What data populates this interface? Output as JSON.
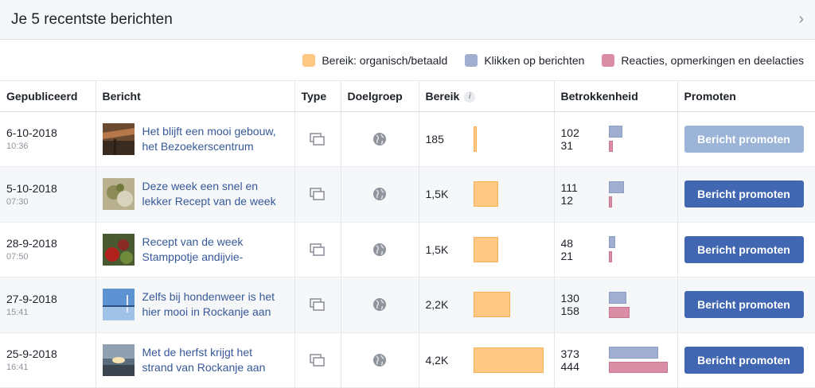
{
  "header": {
    "title": "Je 5 recentste berichten"
  },
  "legend": [
    {
      "label": "Bereik: organisch/betaald",
      "color": "#ffc984"
    },
    {
      "label": "Klikken op berichten",
      "color": "#a0afd0"
    },
    {
      "label": "Reacties, opmerkingen en deelacties",
      "color": "#d98ea6"
    }
  ],
  "columns": [
    "Gepubliceerd",
    "Bericht",
    "Type",
    "Doelgroep",
    "Bereik",
    "Betrokkenheid",
    "Promoten"
  ],
  "rows": [
    {
      "date": "6-10-2018",
      "time": "10:36",
      "title_line1": "Het blijft een mooi gebouw,",
      "title_line2": "het Bezoekerscentrum",
      "reach": "185",
      "reach_value": 185,
      "clicks": "102",
      "reactions": "31",
      "button": "Bericht promoten",
      "disabled": true
    },
    {
      "date": "5-10-2018",
      "time": "07:30",
      "title_line1": "Deze week een snel en",
      "title_line2": "lekker Recept van de week",
      "reach": "1,5K",
      "reach_value": 1500,
      "clicks": "111",
      "reactions": "12",
      "button": "Bericht promoten",
      "disabled": false
    },
    {
      "date": "28-9-2018",
      "time": "07:50",
      "title_line1": "Recept van de week",
      "title_line2": "Stamppotje andijvie-",
      "reach": "1,5K",
      "reach_value": 1500,
      "clicks": "48",
      "reactions": "21",
      "button": "Bericht promoten",
      "disabled": false
    },
    {
      "date": "27-9-2018",
      "time": "15:41",
      "title_line1": "Zelfs bij hondenweer is het",
      "title_line2": "hier mooi in Rockanje aan",
      "reach": "2,2K",
      "reach_value": 2200,
      "clicks": "130",
      "reactions": "158",
      "button": "Bericht promoten",
      "disabled": false
    },
    {
      "date": "25-9-2018",
      "time": "16:41",
      "title_line1": "Met de herfst krijgt het",
      "title_line2": "strand van Rockanje aan",
      "reach": "4,2K",
      "reach_value": 4200,
      "clicks": "373",
      "reactions": "444",
      "button": "Bericht promoten",
      "disabled": false
    }
  ]
}
